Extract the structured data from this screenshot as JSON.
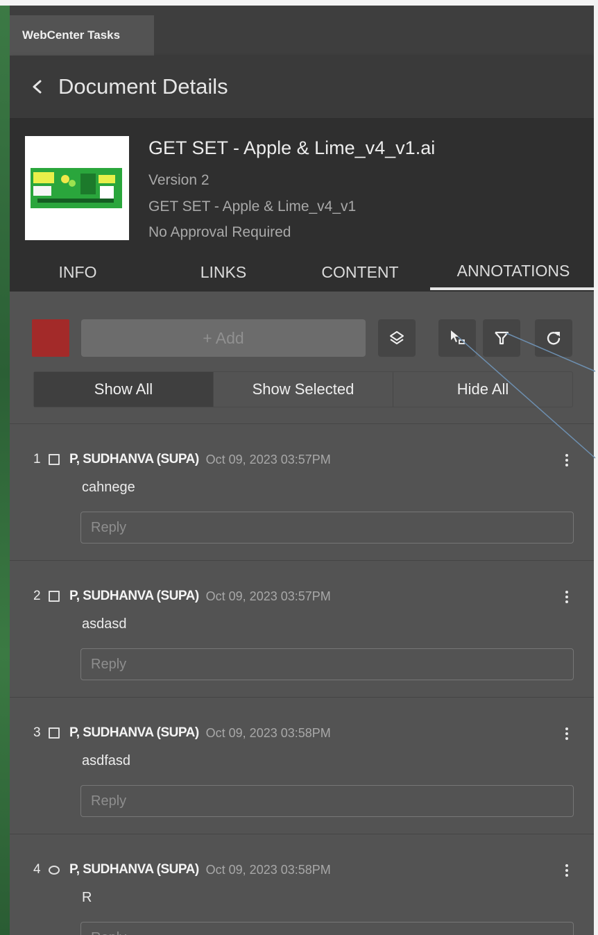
{
  "window": {
    "app_tab": "WebCenter Tasks"
  },
  "header": {
    "title": "Document Details",
    "back_icon": "chevron-left-icon"
  },
  "document": {
    "name": "GET SET - Apple & Lime_v4_v1.ai",
    "version": "Version 2",
    "base_name": "GET SET - Apple & Lime_v4_v1",
    "approval": "No Approval Required"
  },
  "tabs": [
    {
      "label": "INFO",
      "active": false
    },
    {
      "label": "LINKS",
      "active": false
    },
    {
      "label": "CONTENT",
      "active": false
    },
    {
      "label": "ANNOTATIONS",
      "active": true
    }
  ],
  "toolbar": {
    "swatch_color": "#a32a29",
    "add_label": "+ Add",
    "icons": [
      "layers-icon",
      "select-annotation-icon",
      "filter-icon",
      "refresh-icon"
    ]
  },
  "visibility": {
    "options": [
      "Show All",
      "Show Selected",
      "Hide All"
    ],
    "selected": "Show All"
  },
  "annotations": [
    {
      "number": "1",
      "shape": "rectangle",
      "author": "P, SUDHANVA (SUPA)",
      "date": "Oct 09, 2023 03:57PM",
      "text": "cahnege",
      "reply_placeholder": "Reply"
    },
    {
      "number": "2",
      "shape": "rectangle",
      "author": "P, SUDHANVA (SUPA)",
      "date": "Oct 09, 2023 03:57PM",
      "text": "asdasd",
      "reply_placeholder": "Reply"
    },
    {
      "number": "3",
      "shape": "rectangle",
      "author": "P, SUDHANVA (SUPA)",
      "date": "Oct 09, 2023 03:58PM",
      "text": "asdfasd",
      "reply_placeholder": "Reply"
    },
    {
      "number": "4",
      "shape": "ellipse",
      "author": "P, SUDHANVA (SUPA)",
      "date": "Oct 09, 2023 03:58PM",
      "text": "R",
      "reply_placeholder": "Reply"
    }
  ]
}
